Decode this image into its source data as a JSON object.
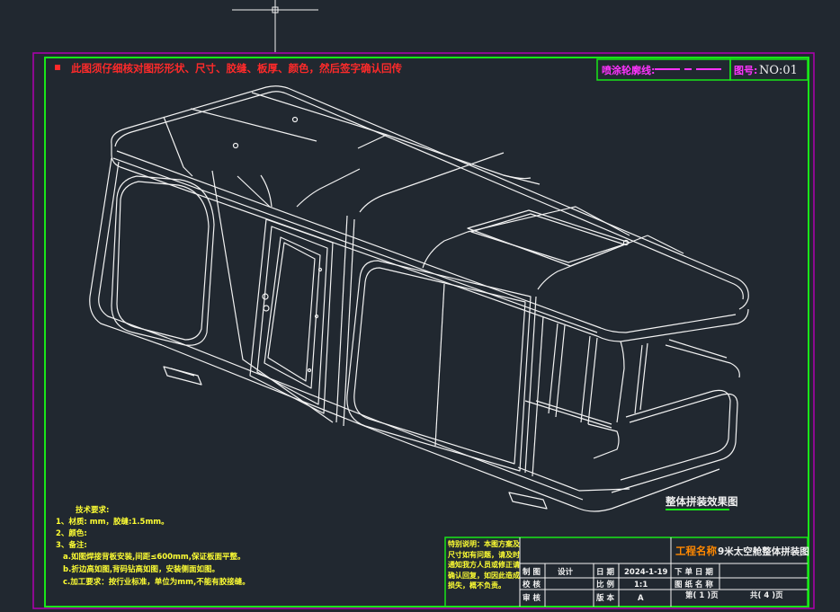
{
  "colors": {
    "background": "#212830",
    "outer_border": "#b000b0",
    "frame_green": "#19e619",
    "line_white": "#f2f2f2",
    "note_red": "#ff2a2a",
    "note_yellow": "#ffff33",
    "magenta": "#ff33ff",
    "title_orange": "#ff8800"
  },
  "header": {
    "note": "此图须仔细核对图形形状、尺寸、胶缝、板厚、颜色，然后签字确认回传",
    "contour_label": "喷涂轮廓线:",
    "figure_no_label": "图号:",
    "figure_no": "NO:01"
  },
  "drawing": {
    "caption": "整体拼装效果图"
  },
  "tech": {
    "title": "技术要求:",
    "line1": "1、材质:     mm，胶缝:1.5mm。",
    "line2": "2、颜色:",
    "line3": "3、备注:",
    "a": "a.如图焊接背板安装,间距≤600mm,保证板面平整。",
    "b": "b.折边高如图,背码钻高如图，安装侧面如图。",
    "c": "c.加工要求：按行业标准，单位为mm,不能有胶接缝。"
  },
  "title_block": {
    "remark": "特别说明：本图方案及尺寸如有问题，请及时通知我方人员或修正请确认回复，如因此造成损失，概不负责。",
    "project_label": "工程名称",
    "project_name": "9米太空舱整体拼装图",
    "drawn_label": "制 图",
    "design": "设计",
    "date_label": "日 期",
    "date": "2024-1-19",
    "order_date_label": "下 单 日 期",
    "check_label": "校 核",
    "scale_label": "比 例",
    "scale": "1:1",
    "drawing_name_label": "图 纸 名 称",
    "approve_label": "审 核",
    "version_label": "版 本",
    "version": "A",
    "page": "第( 1 )页",
    "total": "共( 4 )页"
  }
}
